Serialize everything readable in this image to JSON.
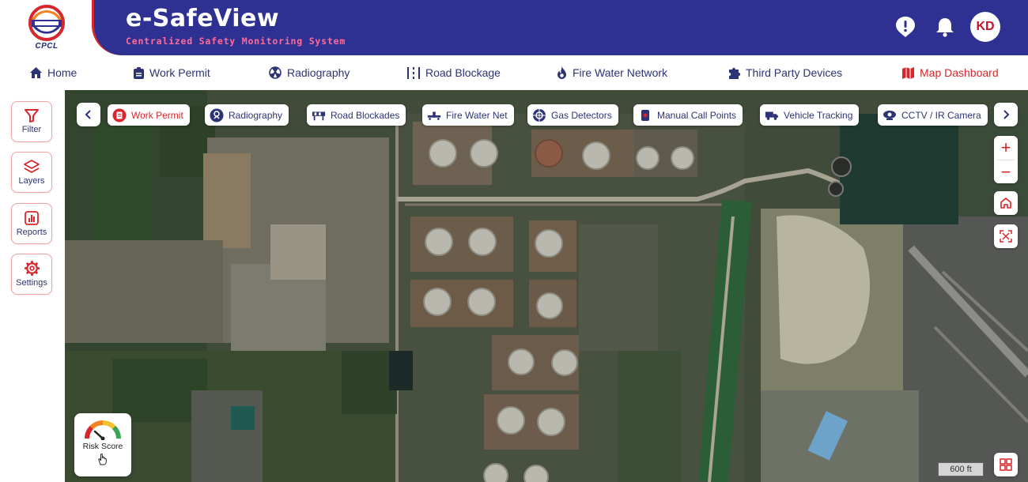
{
  "header": {
    "logo_caption": "CPCL",
    "app_title": "e-SafeView",
    "app_subtitle": "Centralized Safety Monitoring System",
    "alert_icon": "alert-icon",
    "notification_icon": "bell-icon",
    "user_initials": "KD"
  },
  "nav": {
    "items": [
      {
        "label": "Home",
        "icon": "home-icon"
      },
      {
        "label": "Work Permit",
        "icon": "clipboard-icon"
      },
      {
        "label": "Radiography",
        "icon": "radiation-icon"
      },
      {
        "label": "Road Blockage",
        "icon": "road-icon"
      },
      {
        "label": "Fire Water Network",
        "icon": "flame-icon"
      },
      {
        "label": "Third Party Devices",
        "icon": "puzzle-icon"
      },
      {
        "label": "Map Dashboard",
        "icon": "map-icon",
        "active": true
      }
    ]
  },
  "sidebar": {
    "items": [
      {
        "label": "Filter",
        "icon": "filter-icon"
      },
      {
        "label": "Layers",
        "icon": "layers-icon"
      },
      {
        "label": "Reports",
        "icon": "reports-icon"
      },
      {
        "label": "Settings",
        "icon": "gear-icon"
      }
    ]
  },
  "layers": {
    "chips": [
      {
        "label": "Work Permit",
        "icon": "work-permit-icon",
        "active": true
      },
      {
        "label": "Radiography",
        "icon": "radiography-icon"
      },
      {
        "label": "Road Blockades",
        "icon": "road-blockade-icon"
      },
      {
        "label": "Fire Water Net",
        "icon": "fire-water-icon"
      },
      {
        "label": "Gas Detectors",
        "icon": "gas-detector-icon"
      },
      {
        "label": "Manual Call Points",
        "icon": "call-point-icon"
      },
      {
        "label": "Vehicle Tracking",
        "icon": "truck-icon"
      },
      {
        "label": "CCTV / IR Camera",
        "icon": "cctv-icon"
      }
    ]
  },
  "map": {
    "zoom_in": "+",
    "zoom_out": "−",
    "scale_label": "600 ft"
  },
  "risk": {
    "label": "Risk Score"
  },
  "colors": {
    "brand_blue": "#2e3192",
    "accent_red": "#d7262d",
    "nav_text": "#2d3475"
  }
}
